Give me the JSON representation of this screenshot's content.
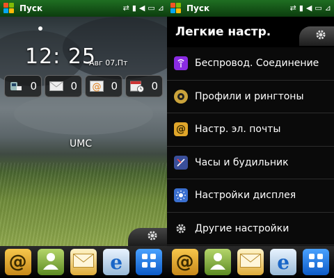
{
  "statusbar": {
    "start_label": "Пуск"
  },
  "today": {
    "time": "12: 25",
    "date": "Авг 07,Пт",
    "operator": "UMC",
    "notifications": [
      {
        "name": "voicemail",
        "count": "0"
      },
      {
        "name": "messages",
        "count": "0"
      },
      {
        "name": "email",
        "count": "0"
      },
      {
        "name": "calendar",
        "count": "0"
      }
    ]
  },
  "settings": {
    "title": "Легкие настр.",
    "items": [
      {
        "label": "Беспровод. Соединение",
        "icon": "wireless-icon",
        "color": "#8a2be2"
      },
      {
        "label": "Профили и рингтоны",
        "icon": "speaker-icon",
        "color": "#caa33b"
      },
      {
        "label": "Настр. эл. почты",
        "icon": "email-at-icon",
        "color": "#e0a62a"
      },
      {
        "label": "Часы и будильник",
        "icon": "clock-icon",
        "color": "#3a4f9a"
      },
      {
        "label": "Настройки дисплея",
        "icon": "display-icon",
        "color": "#3a6fd0"
      },
      {
        "label": "Другие настройки",
        "icon": "gear-icon",
        "color": "#bbbbbb"
      }
    ]
  },
  "colors": {
    "statusbar": "#1f6e22",
    "accent": "#ffba08"
  }
}
